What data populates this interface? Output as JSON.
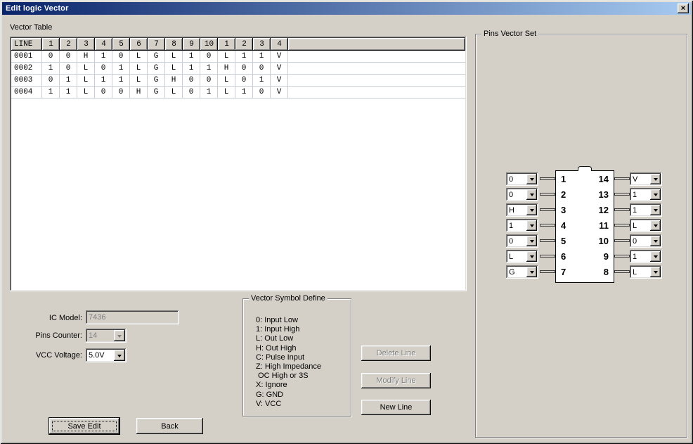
{
  "window": {
    "title": "Edit logic Vector",
    "close": "×"
  },
  "colors": {
    "titlebar_start": "#0a246a",
    "titlebar_end": "#a6caf0",
    "face": "#d4d0c8"
  },
  "vector_table": {
    "label": "Vector Table",
    "headers": [
      "LINE",
      "1",
      "2",
      "3",
      "4",
      "5",
      "6",
      "7",
      "8",
      "9",
      "10",
      "1",
      "2",
      "3",
      "4"
    ],
    "rows": [
      {
        "line": "0001",
        "values": [
          "0",
          "0",
          "H",
          "1",
          "0",
          "L",
          "G",
          "L",
          "1",
          "0",
          "L",
          "1",
          "1",
          "V"
        ]
      },
      {
        "line": "0002",
        "values": [
          "1",
          "0",
          "L",
          "0",
          "1",
          "L",
          "G",
          "L",
          "1",
          "1",
          "H",
          "0",
          "0",
          "V"
        ]
      },
      {
        "line": "0003",
        "values": [
          "0",
          "1",
          "L",
          "1",
          "1",
          "L",
          "G",
          "H",
          "0",
          "0",
          "L",
          "0",
          "1",
          "V"
        ]
      },
      {
        "line": "0004",
        "values": [
          "1",
          "1",
          "L",
          "0",
          "0",
          "H",
          "G",
          "L",
          "0",
          "1",
          "L",
          "1",
          "0",
          "V"
        ]
      }
    ]
  },
  "form": {
    "ic_model": {
      "label": "IC Model:",
      "value": "7436"
    },
    "pins_counter": {
      "label": "Pins Counter:",
      "value": "14"
    },
    "vcc_voltage": {
      "label": "VCC Voltage:",
      "value": "5.0V"
    }
  },
  "symbol_define": {
    "label": "Vector Symbol Define",
    "lines": [
      "0: Input Low",
      "1: Input High",
      "L: Out Low",
      "H: Out High",
      "C: Pulse Input",
      "Z: High Impedance",
      " OC High or 3S",
      "X: Ignore",
      "G: GND",
      "V: VCC"
    ]
  },
  "line_buttons": {
    "delete": "Delete Line",
    "modify": "Modify Line",
    "new": "New Line"
  },
  "bottom_buttons": {
    "save": "Save Edit",
    "back": "Back"
  },
  "pins_vector_set": {
    "label": "Pins Vector Set",
    "left_pins": [
      {
        "pin": "1",
        "value": "0"
      },
      {
        "pin": "2",
        "value": "0"
      },
      {
        "pin": "3",
        "value": "H"
      },
      {
        "pin": "4",
        "value": "1"
      },
      {
        "pin": "5",
        "value": "0"
      },
      {
        "pin": "6",
        "value": "L"
      },
      {
        "pin": "7",
        "value": "G"
      }
    ],
    "right_pins": [
      {
        "pin": "14",
        "value": "V"
      },
      {
        "pin": "13",
        "value": "1"
      },
      {
        "pin": "12",
        "value": "1"
      },
      {
        "pin": "11",
        "value": "L"
      },
      {
        "pin": "10",
        "value": "0"
      },
      {
        "pin": "9",
        "value": "1"
      },
      {
        "pin": "8",
        "value": "L"
      }
    ]
  }
}
